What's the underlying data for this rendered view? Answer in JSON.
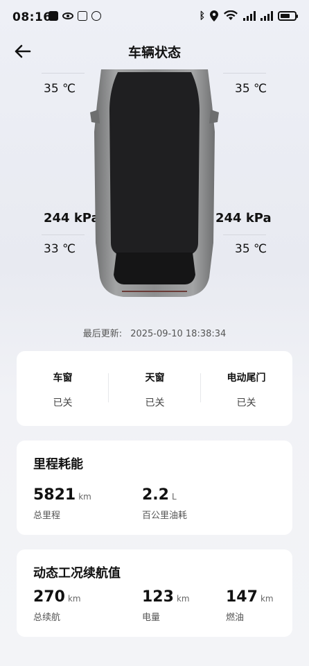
{
  "status_bar": {
    "time": "08:16"
  },
  "header": {
    "title": "车辆状态"
  },
  "tires": {
    "front_left": {
      "temp": "35 ℃"
    },
    "front_right": {
      "temp": "35 ℃"
    },
    "rear_left": {
      "pressure": "244 kPa",
      "temp": "33 ℃"
    },
    "rear_right": {
      "pressure": "244 kPa",
      "temp": "35 ℃"
    }
  },
  "last_update": {
    "label": "最后更新:",
    "value": "2025-09-10 18:38:34"
  },
  "openings": [
    {
      "label": "车窗",
      "value": "已关"
    },
    {
      "label": "天窗",
      "value": "已关"
    },
    {
      "label": "电动尾门",
      "value": "已关"
    }
  ],
  "mileage": {
    "title": "里程耗能",
    "total": {
      "value": "5821",
      "unit": "km",
      "label": "总里程"
    },
    "consumption": {
      "value": "2.2",
      "unit": "L",
      "label": "百公里油耗"
    }
  },
  "range": {
    "title": "动态工况续航值",
    "total": {
      "value": "270",
      "unit": "km",
      "label": "总续航"
    },
    "battery": {
      "value": "123",
      "unit": "km",
      "label": "电量"
    },
    "fuel": {
      "value": "147",
      "unit": "km",
      "label": "燃油"
    }
  },
  "colors": {
    "background": "#eef0f6",
    "card": "#ffffff",
    "car_body": "#8a8b8c",
    "car_roof": "#1f1f21"
  }
}
